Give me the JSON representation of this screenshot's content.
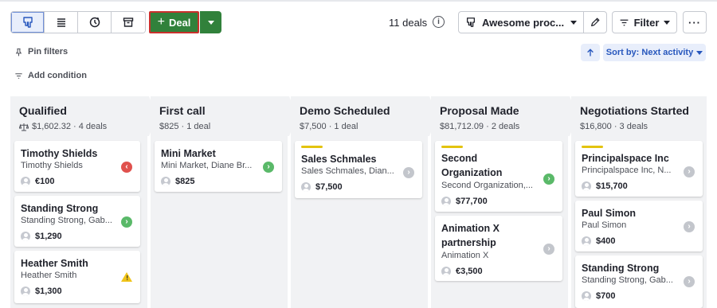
{
  "toolbar": {
    "view_buttons": [
      "pipeline-view",
      "list-view",
      "forecast-view",
      "archive-view"
    ],
    "add_deal_label": "Deal",
    "deals_count": "11 deals",
    "pipeline_name": "Awesome proc...",
    "filter_label": "Filter",
    "more_label": "···"
  },
  "filters": {
    "pin_filters": "Pin filters",
    "add_condition": "Add condition"
  },
  "sort": {
    "label": "Sort by: Next activity"
  },
  "colors": {
    "primary_green": "#31813b",
    "accent_blue": "#2757bd",
    "highlight_red": "#c9302c",
    "label_yellow": "#e3c30f",
    "column_bg": "#f1f2f4"
  },
  "stages": [
    {
      "name": "Qualified",
      "meta": "$1,602.32 · 4 deals",
      "cards": [
        {
          "title": "Timothy Shields",
          "sub": "Timothy Shields",
          "value": "€100",
          "status": "red",
          "label": false
        },
        {
          "title": "Standing Strong",
          "sub": "Standing Strong, Gab...",
          "value": "$1,290",
          "status": "green",
          "label": false
        },
        {
          "title": "Heather Smith",
          "sub": "Heather Smith",
          "value": "$1,300",
          "status": "warn",
          "label": false
        }
      ]
    },
    {
      "name": "First call",
      "meta": "$825 · 1 deal",
      "cards": [
        {
          "title": "Mini Market",
          "sub": "Mini Market, Diane Br...",
          "value": "$825",
          "status": "green",
          "label": false
        }
      ]
    },
    {
      "name": "Demo Scheduled",
      "meta": "$7,500 · 1 deal",
      "cards": [
        {
          "title": "Sales Schmales",
          "sub": "Sales Schmales, Dian...",
          "value": "$7,500",
          "status": "grey",
          "label": true
        }
      ]
    },
    {
      "name": "Proposal Made",
      "meta": "$81,712.09 · 2 deals",
      "cards": [
        {
          "title": "Second Organization",
          "sub": "Second Organization,...",
          "value": "$77,700",
          "status": "green",
          "label": true
        },
        {
          "title": "Animation X partnership",
          "sub": "Animation X",
          "value": "€3,500",
          "status": "grey",
          "label": false
        }
      ]
    },
    {
      "name": "Negotiations Started",
      "meta": "$16,800 · 3 deals",
      "cards": [
        {
          "title": "Principalspace Inc",
          "sub": "Principalspace Inc, N...",
          "value": "$15,700",
          "status": "grey",
          "label": true
        },
        {
          "title": "Paul Simon",
          "sub": "Paul Simon",
          "value": "$400",
          "status": "grey",
          "label": false
        },
        {
          "title": "Standing Strong",
          "sub": "Standing Strong, Gab...",
          "value": "$700",
          "status": "grey",
          "label": false
        }
      ]
    }
  ]
}
